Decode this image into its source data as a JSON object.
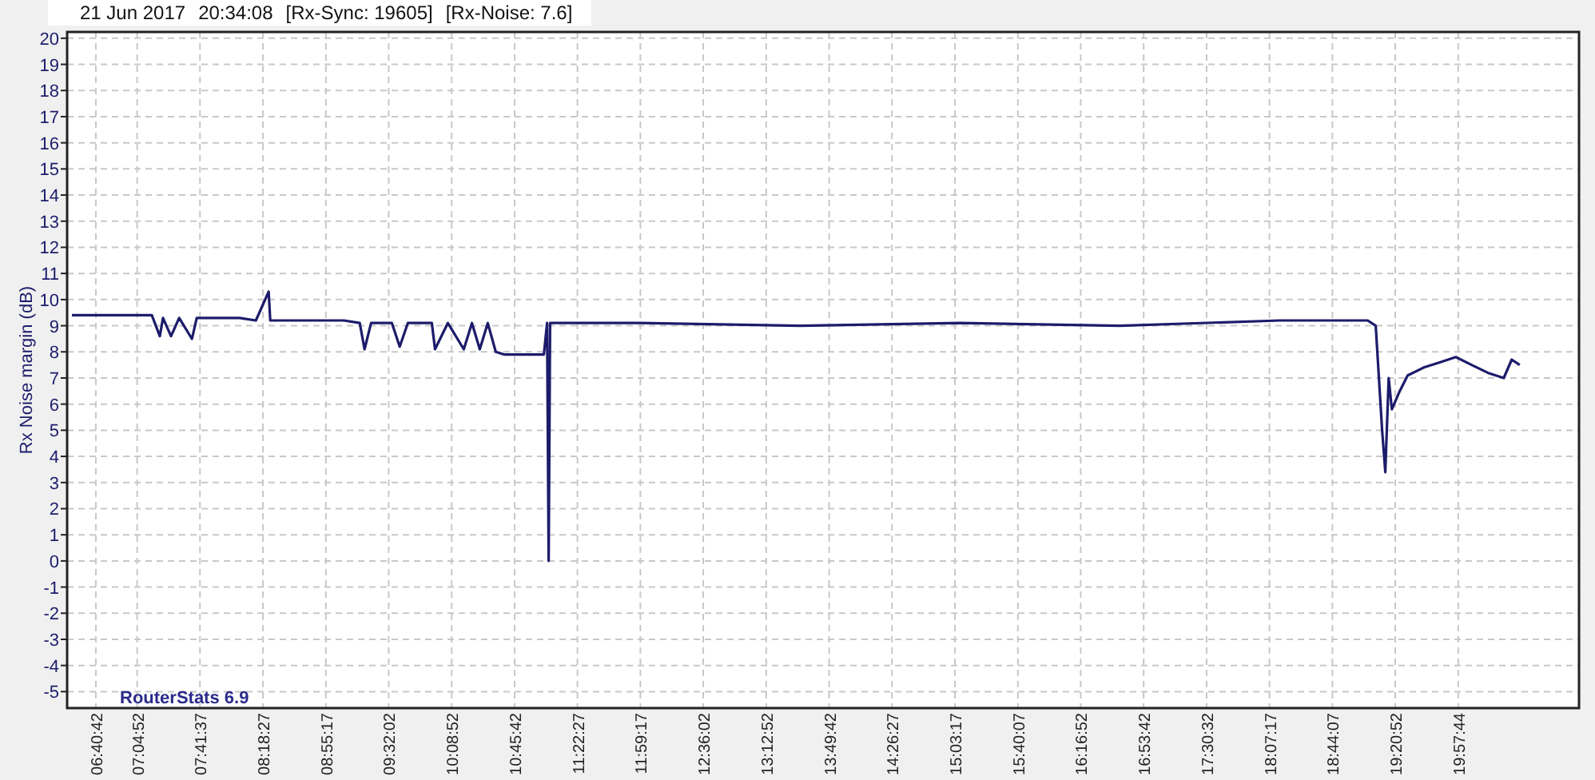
{
  "header": {
    "date": "21 Jun 2017",
    "time": "20:34:08",
    "sync": "[Rx-Sync: 19605]",
    "noise": "[Rx-Noise: 7.6]"
  },
  "chart": {
    "watermark": "RouterStats 6.9",
    "chart_data": {
      "type": "line",
      "ylabel": "Rx Noise margin (dB)",
      "x": [
        386.7,
        433.5,
        438.1,
        440.0,
        444.7,
        449.4,
        456.9,
        459.7,
        484.9,
        494.3,
        501.8,
        502.7,
        545.8,
        555.1,
        557.9,
        561.7,
        573.9,
        578.5,
        583.2,
        597.3,
        599.1,
        606.6,
        616.0,
        620.7,
        625.3,
        630.0,
        634.7,
        639.4,
        662.8,
        664.7,
        665.6,
        666.5,
        718.9,
        812.5,
        906.1,
        999.7,
        1093.3,
        1144.8,
        1149.5,
        1153.2,
        1155.1,
        1157.0,
        1158.9,
        1163.5,
        1168.2,
        1177.6,
        1186.9,
        1196.3,
        1205.6,
        1215.0,
        1224.4,
        1229.0,
        1233.7
      ],
      "series": [
        {
          "color": "#1c1c6b",
          "values": [
            9.4,
            9.4,
            8.6,
            9.3,
            8.6,
            9.3,
            8.5,
            9.3,
            9.3,
            9.2,
            10.3,
            9.2,
            9.2,
            9.1,
            8.1,
            9.1,
            9.1,
            8.2,
            9.1,
            9.1,
            8.1,
            9.1,
            8.1,
            9.1,
            8.1,
            9.1,
            8.0,
            7.9,
            7.9,
            9.1,
            0,
            9.1,
            9.1,
            9.0,
            9.1,
            9.0,
            9.2,
            9.2,
            9.0,
            5,
            3.4,
            7,
            5.8,
            6.5,
            7.1,
            7.4,
            7.6,
            7.8,
            7.5,
            7.2,
            7.0,
            7.7,
            7.5
          ]
        }
      ],
      "grid": true,
      "xlim": [
        383.9,
        1268.4
      ],
      "ylim": [
        -5.63,
        20.24
      ],
      "yticks": [
        -5,
        -4,
        -3,
        -2,
        -1,
        0,
        1,
        2,
        3,
        4,
        5,
        6,
        7,
        8,
        9,
        10,
        11,
        12,
        13,
        14,
        15,
        16,
        17,
        18,
        19,
        20
      ],
      "xticks": [
        {
          "value": 400.7,
          "label": "06:40:42"
        },
        {
          "value": 424.87,
          "label": "07:04:52"
        },
        {
          "value": 461.62,
          "label": "07:41:37"
        },
        {
          "value": 498.45,
          "label": "08:18:27"
        },
        {
          "value": 535.28,
          "label": "08:55:17"
        },
        {
          "value": 572.03,
          "label": "09:32:02"
        },
        {
          "value": 608.87,
          "label": "10:08:52"
        },
        {
          "value": 645.7,
          "label": "10:45:42"
        },
        {
          "value": 682.45,
          "label": "11:22:27"
        },
        {
          "value": 719.28,
          "label": "11:59:17"
        },
        {
          "value": 756.03,
          "label": "12:36:02"
        },
        {
          "value": 792.87,
          "label": "13:12:52"
        },
        {
          "value": 829.7,
          "label": "13:49:42"
        },
        {
          "value": 866.45,
          "label": "14:26:27"
        },
        {
          "value": 903.28,
          "label": "15:03:17"
        },
        {
          "value": 940.12,
          "label": "15:40:07"
        },
        {
          "value": 976.87,
          "label": "16:16:52"
        },
        {
          "value": 1013.7,
          "label": "16:53:42"
        },
        {
          "value": 1050.53,
          "label": "17:30:32"
        },
        {
          "value": 1087.28,
          "label": "18:07:17"
        },
        {
          "value": 1124.12,
          "label": "18:44:07"
        },
        {
          "value": 1160.87,
          "label": "19:20:52"
        },
        {
          "value": 1197.73,
          "label": "19:57:44"
        }
      ]
    }
  }
}
